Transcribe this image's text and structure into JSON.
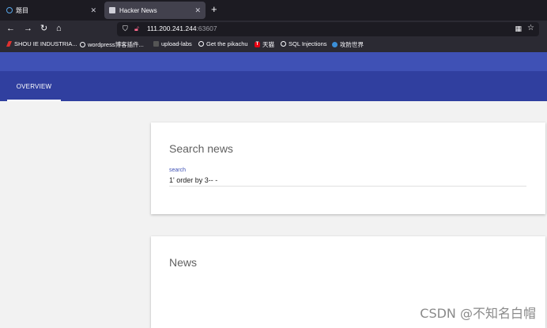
{
  "browser": {
    "tabs": [
      {
        "title": "题目",
        "active": false
      },
      {
        "title": "Hacker News",
        "active": true
      }
    ],
    "new_tab_symbol": "+",
    "url_host": "111.200.241.244",
    "url_port": ":63607",
    "bookmarks": [
      {
        "label": "SHOU IE INDUSTRIA...",
        "icon": "red-flag-icon"
      },
      {
        "label": "wordpress博客插件...",
        "icon": "globe-icon"
      },
      {
        "label": "upload-labs",
        "icon": "dark-page-icon"
      },
      {
        "label": "Get the pikachu",
        "icon": "globe-icon"
      },
      {
        "label": "天猫",
        "icon": "tmall-icon"
      },
      {
        "label": "SQL Injections",
        "icon": "globe-icon"
      },
      {
        "label": "攻防世界",
        "icon": "blue-circle-icon"
      }
    ]
  },
  "app": {
    "tab_label": "OVERVIEW",
    "search_card": {
      "title": "Search news",
      "field_label": "search",
      "field_value": "1' order by 3-- -"
    },
    "news_card": {
      "title": "News"
    },
    "watermark": "CSDN @不知名白帽"
  },
  "colors": {
    "header": "#3f51b5",
    "tabs_bar": "#303f9f",
    "background": "#f2f2f2"
  }
}
